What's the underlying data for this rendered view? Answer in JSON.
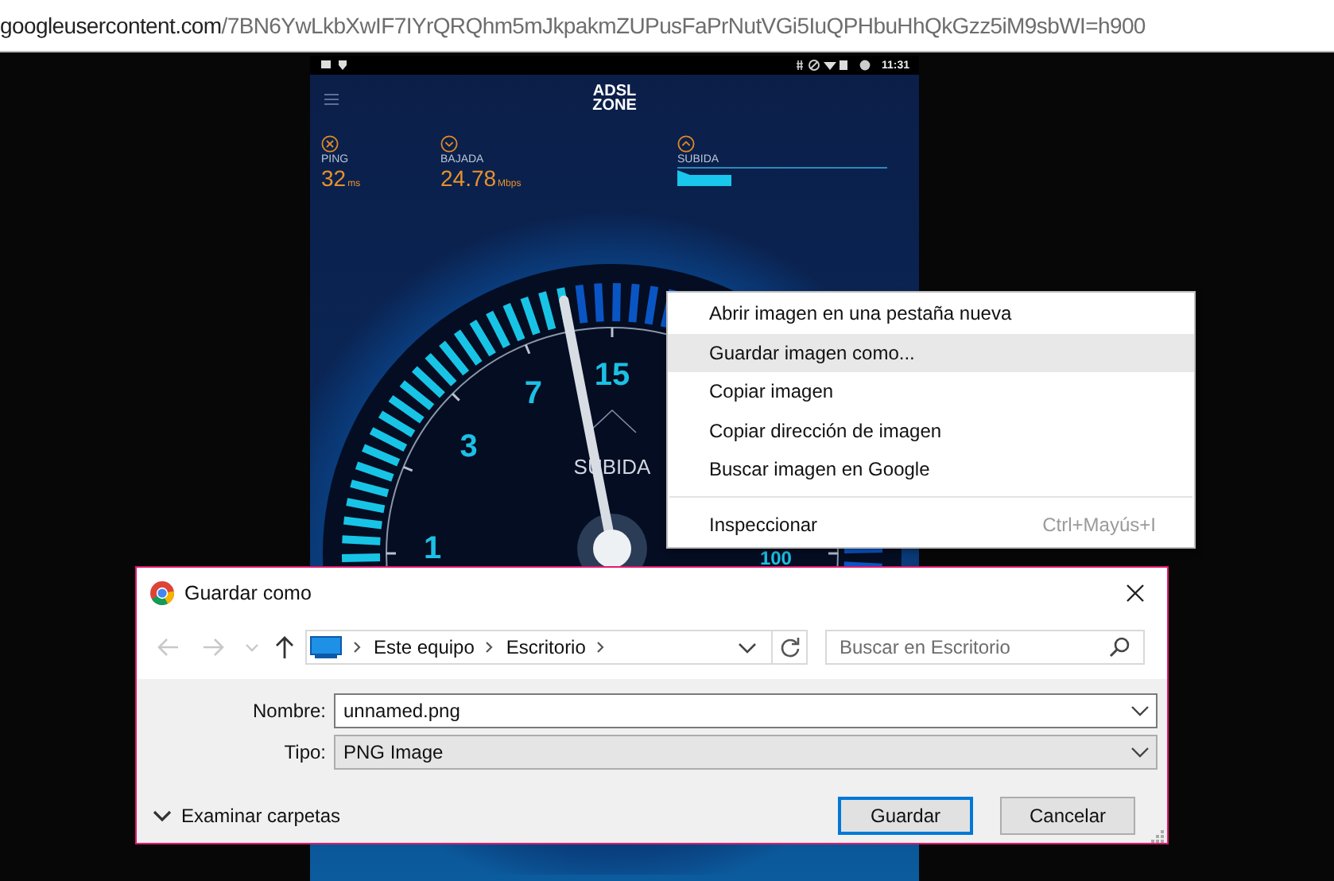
{
  "address_bar": {
    "host": "googleusercontent.com",
    "path": "/7BN6YwLkbXwIF7IYrQRQhm5mJkpakmZUPusFaPrNutVGi5IuQPHbuHhQkGzz5iM9sbWI=h900"
  },
  "phone": {
    "status_time": "11:31",
    "logo": [
      "ADSL",
      "ZONE"
    ],
    "stats": [
      {
        "kind": "value",
        "label": "PING",
        "value": "32",
        "unit": "ms"
      },
      {
        "kind": "value",
        "label": "BAJADA",
        "value": "24.78",
        "unit": "Mbps"
      },
      {
        "kind": "graph",
        "label": "SUBIDA"
      }
    ],
    "gauge": {
      "level": 0.46,
      "scale": [
        "1",
        "3",
        "7",
        "15",
        "100"
      ],
      "label": "SUBIDA"
    }
  },
  "context_menu": {
    "groups": [
      [
        {
          "label": "Abrir imagen en una pestaña nueva",
          "selected": false
        },
        {
          "label": "Guardar imagen como...",
          "selected": true
        },
        {
          "label": "Copiar imagen",
          "selected": false
        },
        {
          "label": "Copiar dirección de imagen",
          "selected": false
        },
        {
          "label": "Buscar imagen en Google",
          "selected": false
        }
      ],
      [
        {
          "label": "Inspeccionar",
          "shortcut": "Ctrl+Mayús+I",
          "selected": false
        }
      ]
    ]
  },
  "dialog": {
    "title": "Guardar como",
    "nav": [
      {
        "kind": "back",
        "disabled": true
      },
      {
        "kind": "forward",
        "disabled": true
      },
      {
        "kind": "recent",
        "disabled": true
      },
      {
        "kind": "up",
        "disabled": false
      }
    ],
    "breadcrumb": [
      "Este equipo",
      "Escritorio"
    ],
    "search": {
      "placeholder": "Buscar en Escritorio"
    },
    "fields": [
      {
        "kind": "text",
        "label": "Nombre:",
        "value": "unnamed.png"
      },
      {
        "kind": "select",
        "label": "Tipo:",
        "value": "PNG Image"
      }
    ],
    "browse": {
      "label": "Examinar carpetas",
      "expanded": false
    },
    "buttons": [
      {
        "label": "Guardar",
        "default": true
      },
      {
        "label": "Cancelar",
        "default": false
      }
    ]
  }
}
